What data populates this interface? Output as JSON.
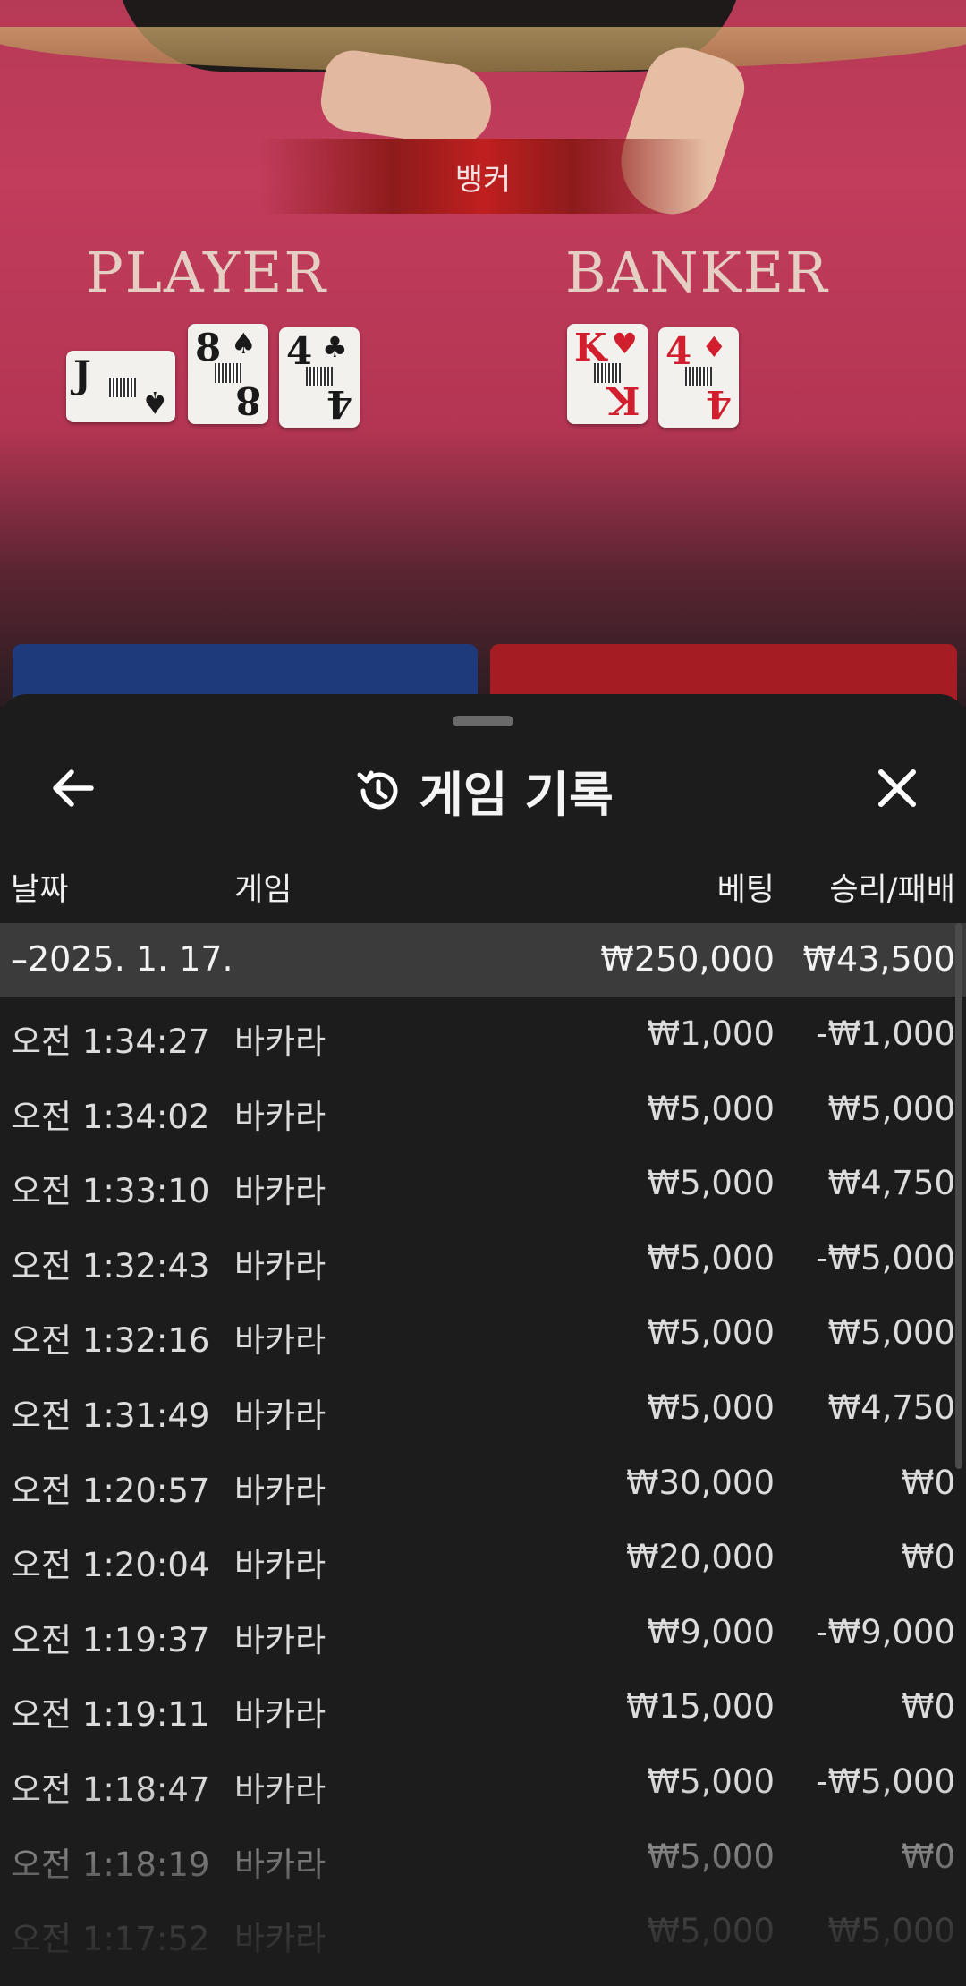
{
  "table": {
    "result_label": "뱅커",
    "player_label": "PLAYER",
    "banker_label": "BANKER",
    "player_cards": [
      {
        "rank": "J",
        "suit": "♠",
        "color": "#1a1a1a"
      },
      {
        "rank": "8",
        "suit": "♠",
        "color": "#1a1a1a"
      },
      {
        "rank": "4",
        "suit": "♣",
        "color": "#1a1a1a"
      }
    ],
    "banker_cards": [
      {
        "rank": "K",
        "suit": "♥",
        "color": "#d11f2e"
      },
      {
        "rank": "4",
        "suit": "♦",
        "color": "#d11f2e"
      }
    ]
  },
  "sheet": {
    "back_icon": "arrow-left-icon",
    "history_icon": "history-icon",
    "close_icon": "close-icon",
    "title": "게임 기록",
    "columns": {
      "date": "날짜",
      "game": "게임",
      "bet": "베팅",
      "win": "승리/패배"
    },
    "summary": {
      "date": "–2025. 1. 17.",
      "bet": "₩250,000",
      "win": "₩43,500"
    },
    "rows": [
      {
        "time": "오전 1:34:27",
        "game": "바카라",
        "bet": "₩1,000",
        "win": "-₩1,000"
      },
      {
        "time": "오전 1:34:02",
        "game": "바카라",
        "bet": "₩5,000",
        "win": "₩5,000"
      },
      {
        "time": "오전 1:33:10",
        "game": "바카라",
        "bet": "₩5,000",
        "win": "₩4,750"
      },
      {
        "time": "오전 1:32:43",
        "game": "바카라",
        "bet": "₩5,000",
        "win": "-₩5,000"
      },
      {
        "time": "오전 1:32:16",
        "game": "바카라",
        "bet": "₩5,000",
        "win": "₩5,000"
      },
      {
        "time": "오전 1:31:49",
        "game": "바카라",
        "bet": "₩5,000",
        "win": "₩4,750"
      },
      {
        "time": "오전 1:20:57",
        "game": "바카라",
        "bet": "₩30,000",
        "win": "₩0"
      },
      {
        "time": "오전 1:20:04",
        "game": "바카라",
        "bet": "₩20,000",
        "win": "₩0"
      },
      {
        "time": "오전 1:19:37",
        "game": "바카라",
        "bet": "₩9,000",
        "win": "-₩9,000"
      },
      {
        "time": "오전 1:19:11",
        "game": "바카라",
        "bet": "₩15,000",
        "win": "₩0"
      },
      {
        "time": "오전 1:18:47",
        "game": "바카라",
        "bet": "₩5,000",
        "win": "-₩5,000"
      },
      {
        "time": "오전 1:18:19",
        "game": "바카라",
        "bet": "₩5,000",
        "win": "₩0"
      },
      {
        "time": "오전 1:17:52",
        "game": "바카라",
        "bet": "₩5,000",
        "win": "₩5,000"
      }
    ]
  }
}
